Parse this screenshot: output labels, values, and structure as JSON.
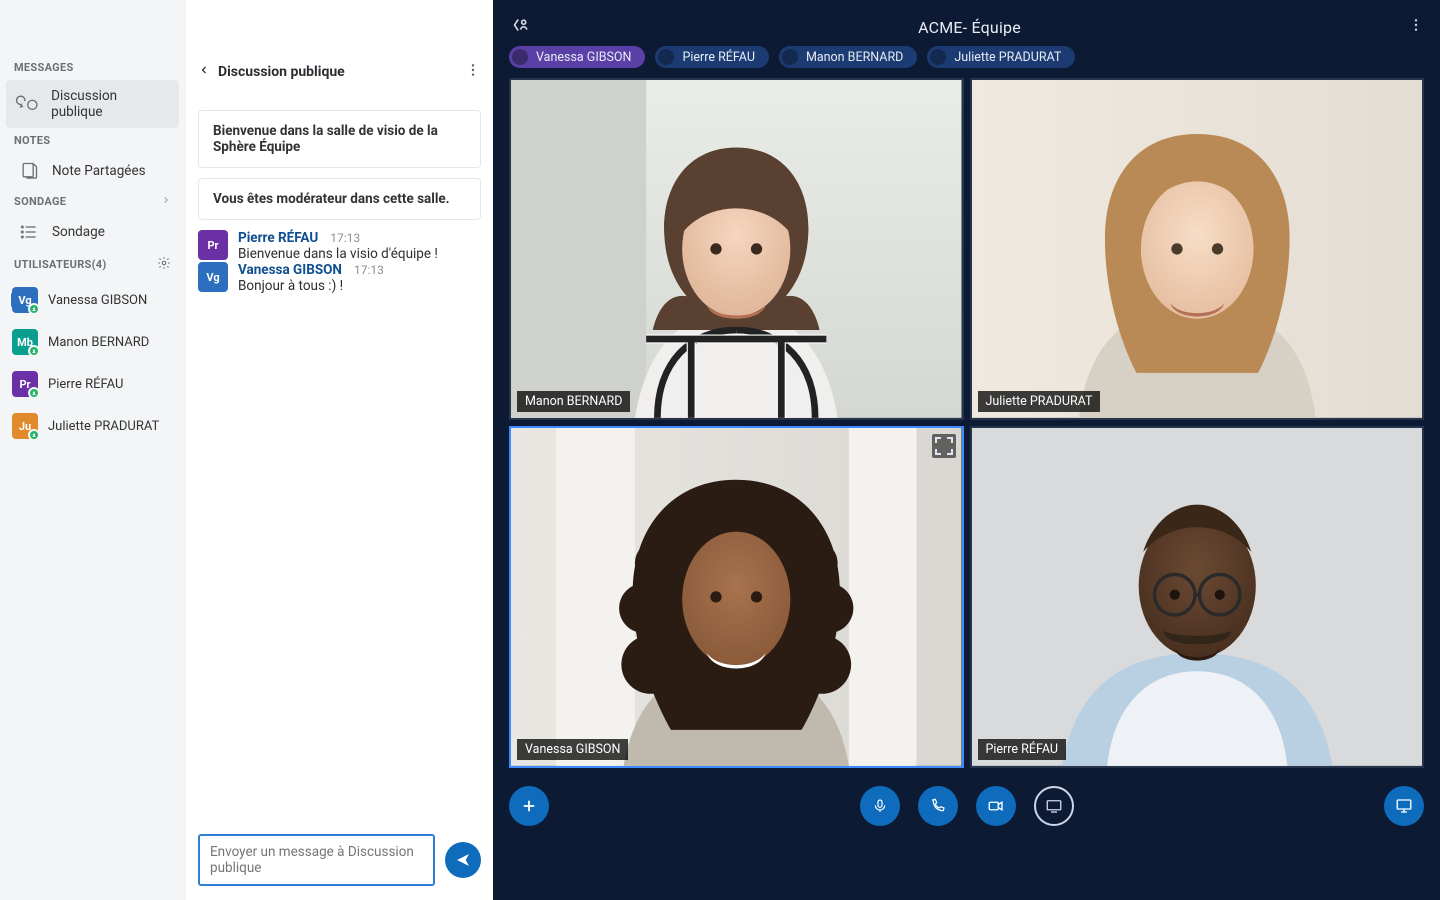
{
  "sidebar": {
    "messages_header": "MESSAGES",
    "discussion_label": "Discussion publique",
    "notes_header": "NOTES",
    "notes_label": "Note Partagées",
    "poll_header": "SONDAGE",
    "poll_label": "Sondage",
    "users_header": "UTILISATEURS(4)",
    "users": [
      {
        "initials": "Vg",
        "name": "Vanessa GIBSON",
        "color": "blue"
      },
      {
        "initials": "Mb",
        "name": "Manon BERNARD",
        "color": "teal"
      },
      {
        "initials": "Pr",
        "name": "Pierre RÉFAU",
        "color": "purple"
      },
      {
        "initials": "Ju",
        "name": "Juliette PRADURAT",
        "color": "orange"
      }
    ]
  },
  "chat": {
    "title": "Discussion publique",
    "welcome_card": "Bienvenue dans la salle de visio de la Sphère Équipe",
    "moderator_card": "Vous êtes modérateur dans cette salle.",
    "messages": [
      {
        "initials": "Pr",
        "color": "purple",
        "name": "Pierre RÉFAU",
        "time": "17:13",
        "text": "Bienvenue dans la visio d'équipe !"
      },
      {
        "initials": "Vg",
        "color": "blue",
        "name": "Vanessa GIBSON",
        "time": "17:13",
        "text": "Bonjour à tous :) !"
      }
    ],
    "compose_placeholder": "Envoyer un message à Discussion publique"
  },
  "video": {
    "room_title": "ACME- Équipe",
    "pills": [
      {
        "name": "Vanessa GIBSON",
        "style": "purple"
      },
      {
        "name": "Pierre  RÉFAU",
        "style": "navy"
      },
      {
        "name": "Manon BERNARD",
        "style": "navy"
      },
      {
        "name": "Juliette PRADURAT",
        "style": "navy"
      }
    ],
    "tiles": [
      {
        "name": "Manon BERNARD",
        "active": false
      },
      {
        "name": "Juliette PRADURAT",
        "active": false
      },
      {
        "name": "Vanessa GIBSON",
        "active": true
      },
      {
        "name": "Pierre RÉFAU",
        "active": false
      }
    ]
  }
}
